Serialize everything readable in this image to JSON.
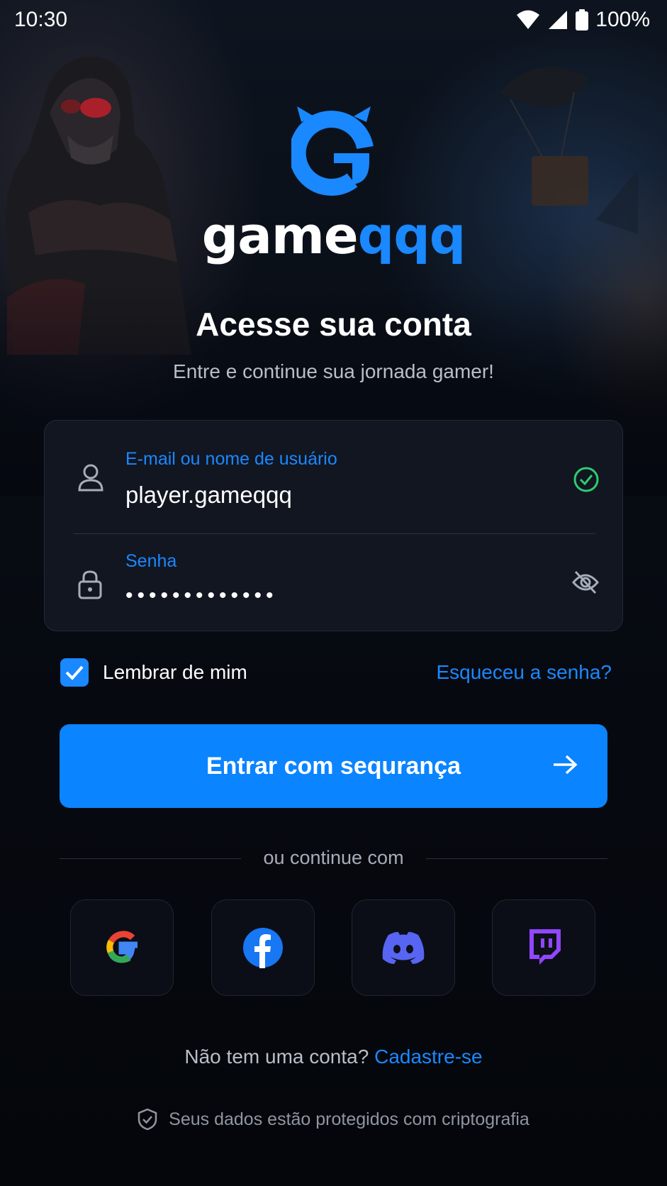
{
  "status_bar": {
    "time": "10:30",
    "battery": "100%"
  },
  "brand": {
    "name_part1": "game",
    "name_part2": "qqq",
    "accent_color": "#1a88ff"
  },
  "header": {
    "title": "Acesse sua conta",
    "subtitle": "Entre e continue sua jornada gamer!"
  },
  "form": {
    "email": {
      "label": "E-mail ou nome de usuário",
      "value": "player.gameqqq",
      "icon": "user-icon",
      "status_icon": "check-circle-icon"
    },
    "password": {
      "label": "Senha",
      "value": "•••••••••••••",
      "icon": "lock-icon",
      "toggle_icon": "eye-off-icon"
    },
    "remember_label": "Lembrar de mim",
    "remember_checked": true,
    "forgot_label": "Esqueceu a senha?",
    "submit_label": "Entrar com sequrança"
  },
  "social": {
    "divider_text": "ou continue com",
    "providers": [
      "google",
      "facebook",
      "discord",
      "twitch"
    ]
  },
  "footer": {
    "signup_prompt": "Não tem uma conta?",
    "signup_link": "Cadastre-se",
    "security_note": "Seus dados estão protegidos com criptografia"
  }
}
